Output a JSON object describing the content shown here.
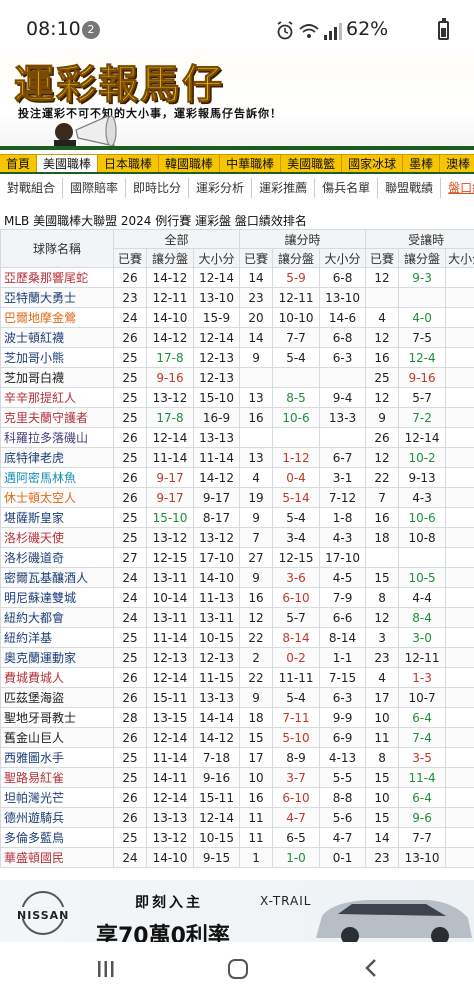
{
  "status_bar": {
    "time": "08:10",
    "notification_count": "2",
    "battery": "62%"
  },
  "banner": {
    "title": "運彩報馬仔",
    "subtitle": "投注運彩不可不知的大小事，運彩報馬仔告訴你！"
  },
  "nav_main": [
    {
      "label": "首頁",
      "active": false
    },
    {
      "label": "美國職棒",
      "active": true
    },
    {
      "label": "日本職棒",
      "active": false
    },
    {
      "label": "韓國職棒",
      "active": false
    },
    {
      "label": "中華職棒",
      "active": false
    },
    {
      "label": "美國職籃",
      "active": false
    },
    {
      "label": "國家冰球",
      "active": false
    },
    {
      "label": "墨棒",
      "active": false
    },
    {
      "label": "澳棒",
      "active": false
    }
  ],
  "nav_sub": [
    {
      "label": "對戰組合",
      "active": false
    },
    {
      "label": "國際賠率",
      "active": false
    },
    {
      "label": "即時比分",
      "active": false
    },
    {
      "label": "運彩分析",
      "active": false
    },
    {
      "label": "運彩推薦",
      "active": false
    },
    {
      "label": "傷兵名單",
      "active": false
    },
    {
      "label": "聯盟戰績",
      "active": false
    },
    {
      "label": "盤口績效",
      "active": true
    }
  ],
  "table": {
    "heading": "MLB 美國職棒大聯盟 2024 例行賽 運彩盤 盤口績效排名",
    "team_header": "球隊名稱",
    "groups": [
      "全部",
      "讓分時",
      "受讓時"
    ],
    "sub_headers": [
      "已賽",
      "讓分盤",
      "大小分",
      "已賽",
      "讓分盤",
      "大小分",
      "已賽",
      "讓分盤",
      "大小分"
    ],
    "rows": [
      {
        "team": "亞歷桑那響尾蛇",
        "team_color": "#b5323c",
        "c": [
          "26",
          "14-12",
          "12-14",
          "14",
          "5-9",
          "6-8",
          "12",
          "9-3",
          ""
        ],
        "s": [
          "",
          "",
          "",
          "",
          "r",
          "",
          "",
          "g",
          ""
        ]
      },
      {
        "team": "亞特蘭大勇士",
        "team_color": "#1d3f7a",
        "c": [
          "23",
          "12-11",
          "13-10",
          "23",
          "12-11",
          "13-10",
          "",
          "",
          ""
        ],
        "s": [
          "",
          "",
          "",
          "",
          "",
          "",
          "",
          "",
          ""
        ]
      },
      {
        "team": "巴爾地摩金鶯",
        "team_color": "#df6a16",
        "c": [
          "24",
          "14-10",
          "15-9",
          "20",
          "10-10",
          "14-6",
          "4",
          "4-0",
          ""
        ],
        "s": [
          "",
          "",
          "",
          "",
          "",
          "",
          "",
          "g",
          ""
        ]
      },
      {
        "team": "波士頓紅襪",
        "team_color": "#1d3f7a",
        "c": [
          "26",
          "14-12",
          "12-14",
          "14",
          "7-7",
          "6-8",
          "12",
          "7-5",
          ""
        ],
        "s": [
          "",
          "",
          "",
          "",
          "",
          "",
          "",
          "",
          ""
        ]
      },
      {
        "team": "芝加哥小熊",
        "team_color": "#1d3f7a",
        "c": [
          "25",
          "17-8",
          "12-13",
          "9",
          "5-4",
          "6-3",
          "16",
          "12-4",
          ""
        ],
        "s": [
          "",
          "g",
          "",
          "",
          "",
          "",
          "",
          "g",
          ""
        ]
      },
      {
        "team": "芝加哥白襪",
        "team_color": "#222222",
        "c": [
          "25",
          "9-16",
          "12-13",
          "",
          "",
          "",
          "25",
          "9-16",
          ""
        ],
        "s": [
          "",
          "r",
          "",
          "",
          "",
          "",
          "",
          "r",
          ""
        ]
      },
      {
        "team": "辛辛那提紅人",
        "team_color": "#b5323c",
        "c": [
          "25",
          "13-12",
          "15-10",
          "13",
          "8-5",
          "9-4",
          "12",
          "5-7",
          ""
        ],
        "s": [
          "",
          "",
          "",
          "",
          "g",
          "",
          "",
          "",
          ""
        ]
      },
      {
        "team": "克里夫蘭守護者",
        "team_color": "#b5323c",
        "c": [
          "25",
          "17-8",
          "16-9",
          "16",
          "10-6",
          "13-3",
          "9",
          "7-2",
          ""
        ],
        "s": [
          "",
          "g",
          "",
          "",
          "g",
          "",
          "",
          "g",
          ""
        ]
      },
      {
        "team": "科羅拉多落磯山",
        "team_color": "#4a3d7a",
        "c": [
          "26",
          "12-14",
          "13-13",
          "",
          "",
          "",
          "26",
          "12-14",
          ""
        ],
        "s": [
          "",
          "",
          "",
          "",
          "",
          "",
          "",
          "",
          ""
        ]
      },
      {
        "team": "底特律老虎",
        "team_color": "#1d3f7a",
        "c": [
          "25",
          "11-14",
          "11-14",
          "13",
          "1-12",
          "6-7",
          "12",
          "10-2",
          ""
        ],
        "s": [
          "",
          "",
          "",
          "",
          "r",
          "",
          "",
          "g",
          ""
        ]
      },
      {
        "team": "邁阿密馬林魚",
        "team_color": "#1a8fb0",
        "c": [
          "26",
          "9-17",
          "14-12",
          "4",
          "0-4",
          "3-1",
          "22",
          "9-13",
          ""
        ],
        "s": [
          "",
          "r",
          "",
          "",
          "r",
          "",
          "",
          "",
          ""
        ]
      },
      {
        "team": "休士頓太空人",
        "team_color": "#df6a16",
        "c": [
          "26",
          "9-17",
          "9-17",
          "19",
          "5-14",
          "7-12",
          "7",
          "4-3",
          ""
        ],
        "s": [
          "",
          "r",
          "",
          "",
          "r",
          "",
          "",
          "",
          ""
        ]
      },
      {
        "team": "堪薩斯皇家",
        "team_color": "#1d3f7a",
        "c": [
          "25",
          "15-10",
          "8-17",
          "9",
          "5-4",
          "1-8",
          "16",
          "10-6",
          ""
        ],
        "s": [
          "",
          "g",
          "",
          "",
          "",
          "",
          "",
          "g",
          ""
        ]
      },
      {
        "team": "洛杉磯天使",
        "team_color": "#b5323c",
        "c": [
          "25",
          "13-12",
          "13-12",
          "7",
          "3-4",
          "4-3",
          "18",
          "10-8",
          ""
        ],
        "s": [
          "",
          "",
          "",
          "",
          "",
          "",
          "",
          "",
          ""
        ]
      },
      {
        "team": "洛杉磯道奇",
        "team_color": "#1d3f7a",
        "c": [
          "27",
          "12-15",
          "17-10",
          "27",
          "12-15",
          "17-10",
          "",
          "",
          ""
        ],
        "s": [
          "",
          "",
          "",
          "",
          "",
          "",
          "",
          "",
          ""
        ]
      },
      {
        "team": "密爾瓦基釀酒人",
        "team_color": "#1d3f7a",
        "c": [
          "24",
          "13-11",
          "14-10",
          "9",
          "3-6",
          "4-5",
          "15",
          "10-5",
          ""
        ],
        "s": [
          "",
          "",
          "",
          "",
          "r",
          "",
          "",
          "g",
          ""
        ]
      },
      {
        "team": "明尼蘇達雙城",
        "team_color": "#1d3f7a",
        "c": [
          "24",
          "10-14",
          "11-13",
          "16",
          "6-10",
          "7-9",
          "8",
          "4-4",
          ""
        ],
        "s": [
          "",
          "",
          "",
          "",
          "r",
          "",
          "",
          "",
          ""
        ]
      },
      {
        "team": "紐約大都會",
        "team_color": "#1d3f7a",
        "c": [
          "24",
          "13-11",
          "13-11",
          "12",
          "5-7",
          "6-6",
          "12",
          "8-4",
          ""
        ],
        "s": [
          "",
          "",
          "",
          "",
          "",
          "",
          "",
          "g",
          ""
        ]
      },
      {
        "team": "紐約洋基",
        "team_color": "#1d3f7a",
        "c": [
          "25",
          "11-14",
          "10-15",
          "22",
          "8-14",
          "8-14",
          "3",
          "3-0",
          ""
        ],
        "s": [
          "",
          "",
          "",
          "",
          "r",
          "",
          "",
          "g",
          ""
        ]
      },
      {
        "team": "奧克蘭運動家",
        "team_color": "#1d3f7a",
        "c": [
          "25",
          "12-13",
          "12-13",
          "2",
          "0-2",
          "1-1",
          "23",
          "12-11",
          ""
        ],
        "s": [
          "",
          "",
          "",
          "",
          "r",
          "",
          "",
          "",
          ""
        ]
      },
      {
        "team": "費城費城人",
        "team_color": "#b5323c",
        "c": [
          "26",
          "12-14",
          "11-15",
          "22",
          "11-11",
          "7-15",
          "4",
          "1-3",
          ""
        ],
        "s": [
          "",
          "",
          "",
          "",
          "",
          "",
          "",
          "r",
          ""
        ]
      },
      {
        "team": "匹茲堡海盜",
        "team_color": "#222222",
        "c": [
          "26",
          "15-11",
          "13-13",
          "9",
          "5-4",
          "6-3",
          "17",
          "10-7",
          ""
        ],
        "s": [
          "",
          "",
          "",
          "",
          "",
          "",
          "",
          "",
          ""
        ]
      },
      {
        "team": "聖地牙哥教士",
        "team_color": "#222222",
        "c": [
          "28",
          "13-15",
          "14-14",
          "18",
          "7-11",
          "9-9",
          "10",
          "6-4",
          ""
        ],
        "s": [
          "",
          "",
          "",
          "",
          "r",
          "",
          "",
          "g",
          ""
        ]
      },
      {
        "team": "舊金山巨人",
        "team_color": "#222222",
        "c": [
          "26",
          "12-14",
          "14-12",
          "15",
          "5-10",
          "6-9",
          "11",
          "7-4",
          ""
        ],
        "s": [
          "",
          "",
          "",
          "",
          "r",
          "",
          "",
          "g",
          ""
        ]
      },
      {
        "team": "西雅圖水手",
        "team_color": "#1d3f7a",
        "c": [
          "25",
          "11-14",
          "7-18",
          "17",
          "8-9",
          "4-13",
          "8",
          "3-5",
          ""
        ],
        "s": [
          "",
          "",
          "",
          "",
          "",
          "",
          "",
          "r",
          ""
        ]
      },
      {
        "team": "聖路易紅雀",
        "team_color": "#b5323c",
        "c": [
          "25",
          "14-11",
          "9-16",
          "10",
          "3-7",
          "5-5",
          "15",
          "11-4",
          ""
        ],
        "s": [
          "",
          "",
          "",
          "",
          "r",
          "",
          "",
          "g",
          ""
        ]
      },
      {
        "team": "坦帕灣光芒",
        "team_color": "#1d3f7a",
        "c": [
          "26",
          "12-14",
          "15-11",
          "16",
          "6-10",
          "8-8",
          "10",
          "6-4",
          ""
        ],
        "s": [
          "",
          "",
          "",
          "",
          "r",
          "",
          "",
          "g",
          ""
        ]
      },
      {
        "team": "德州遊騎兵",
        "team_color": "#1d3f7a",
        "c": [
          "26",
          "13-13",
          "12-14",
          "11",
          "4-7",
          "5-6",
          "15",
          "9-6",
          ""
        ],
        "s": [
          "",
          "",
          "",
          "",
          "r",
          "",
          "",
          "g",
          ""
        ]
      },
      {
        "team": "多倫多藍鳥",
        "team_color": "#1d3f7a",
        "c": [
          "25",
          "13-12",
          "10-15",
          "11",
          "6-5",
          "4-7",
          "14",
          "7-7",
          ""
        ],
        "s": [
          "",
          "",
          "",
          "",
          "",
          "",
          "",
          "",
          ""
        ]
      },
      {
        "team": "華盛頓國民",
        "team_color": "#b5323c",
        "c": [
          "24",
          "14-10",
          "9-15",
          "1",
          "1-0",
          "0-1",
          "23",
          "13-10",
          ""
        ],
        "s": [
          "",
          "",
          "",
          "",
          "g",
          "",
          "",
          "",
          ""
        ]
      }
    ]
  },
  "ad": {
    "brand": "NISSAN",
    "headline": "即刻入主",
    "model": "X-TRAIL",
    "line2": "享70萬0利率"
  },
  "colors": {
    "nav_yellow": "#f7c600",
    "banner_green": "#1b5e20",
    "positive": "#1e8e3e",
    "negative": "#c0392b"
  }
}
